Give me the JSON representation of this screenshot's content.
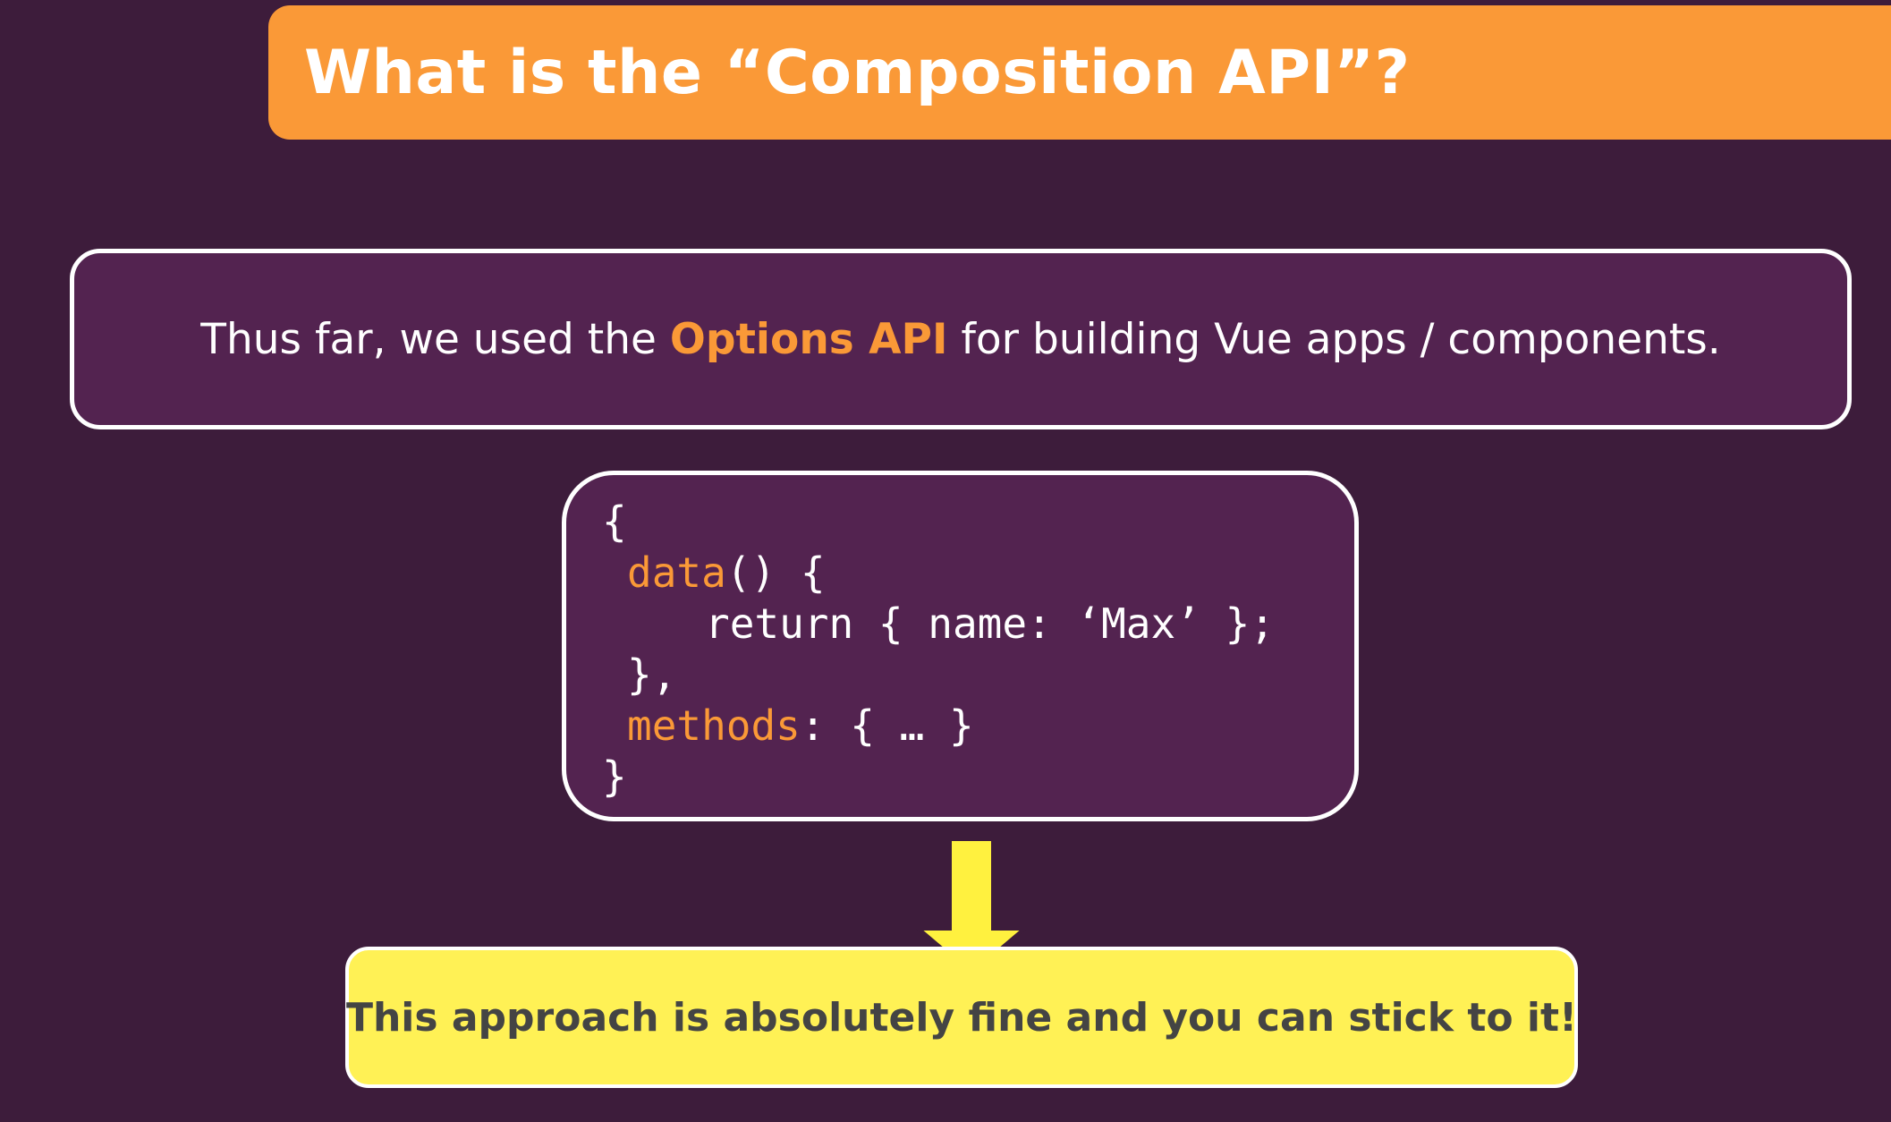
{
  "title": "What is the “Composition API”?",
  "intro": {
    "before": "Thus far, we used the ",
    "highlight": "Options API",
    "after": " for building Vue apps / components."
  },
  "code": {
    "line1": "{",
    "line2_kw": "data",
    "line2_rest": "() {",
    "line3": "return { name: ‘Max’ };",
    "line4": "},",
    "line5_kw": "methods",
    "line5_rest": ": { … }",
    "line6": "}"
  },
  "conclusion": "This approach is absolutely fine and you can stick to it!",
  "colors": {
    "background": "#3d1c3b",
    "panel": "#532350",
    "accent_orange": "#fa9937",
    "yellow": "#fff155",
    "arrow_yellow": "#fff13f",
    "conclusion_text": "#444444"
  },
  "icons": {
    "arrow": "arrow-down-icon"
  }
}
